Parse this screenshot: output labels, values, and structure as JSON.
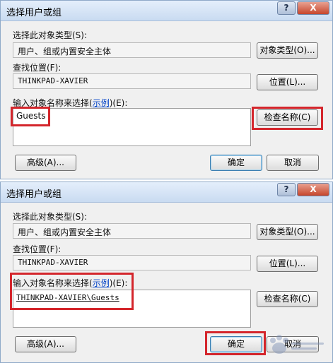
{
  "dialogs": [
    {
      "title": "选择用户或组",
      "object_type_label": "选择此对象类型(S):",
      "object_type_value": "用户、组或内置安全主体",
      "object_type_button": "对象类型(O)...",
      "location_label": "查找位置(F):",
      "location_value": "THINKPAD-XAVIER",
      "location_button": "位置(L)...",
      "name_label_pre": "输入对象名称来选择(",
      "name_label_link": "示例",
      "name_label_post": ")(E):",
      "name_value": "Guests",
      "check_names_button": "检查名称(C)",
      "advanced_button": "高级(A)...",
      "ok_button": "确定",
      "cancel_button": "取消"
    },
    {
      "title": "选择用户或组",
      "object_type_label": "选择此对象类型(S):",
      "object_type_value": "用户、组或内置安全主体",
      "object_type_button": "对象类型(O)...",
      "location_label": "查找位置(F):",
      "location_value": "THINKPAD-XAVIER",
      "location_button": "位置(L)...",
      "name_label_pre": "输入对象名称来选择(",
      "name_label_link": "示例",
      "name_label_post": ")(E):",
      "name_value": "THINKPAD-XAVIER\\Guests",
      "check_names_button": "检查名称(C)",
      "advanced_button": "高级(A)...",
      "ok_button": "确定",
      "cancel_button": "取消"
    }
  ],
  "titlebar": {
    "help_glyph": "?",
    "close_glyph": "X"
  },
  "colors": {
    "highlight": "#d4262c",
    "link": "#0645c8"
  },
  "icons": [
    "help-icon",
    "close-icon",
    "watermark-paw-icon"
  ]
}
